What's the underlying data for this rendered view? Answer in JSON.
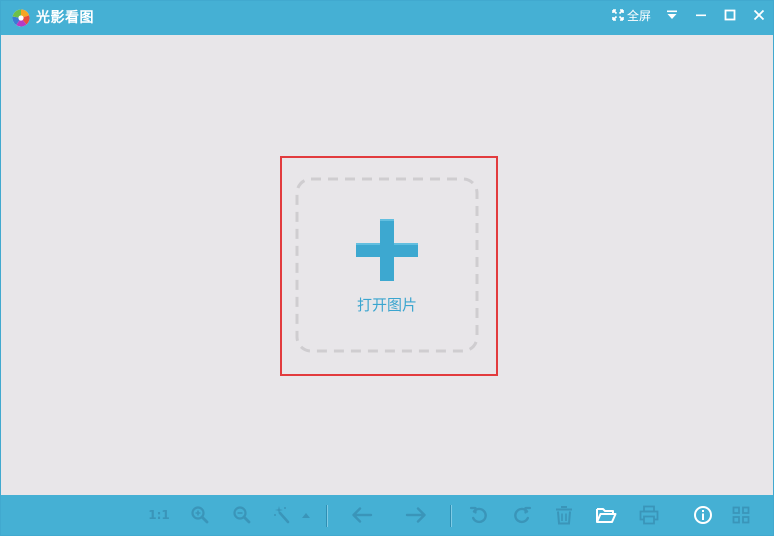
{
  "app": {
    "title": "光影看图",
    "fullscreen_label": "全屏"
  },
  "main": {
    "open_label": "打开图片"
  },
  "toolbar": {
    "ratio_label": "1:1",
    "items": [
      {
        "name": "actual-size",
        "icon": "ratio-1-1"
      },
      {
        "name": "zoom-in",
        "icon": "zoom-in-icon"
      },
      {
        "name": "zoom-out",
        "icon": "zoom-out-icon"
      },
      {
        "name": "edit",
        "icon": "magic-wand-icon"
      },
      {
        "name": "previous",
        "icon": "arrow-left-icon"
      },
      {
        "name": "next",
        "icon": "arrow-right-icon"
      },
      {
        "name": "rotate-left",
        "icon": "rotate-left-icon"
      },
      {
        "name": "rotate-right",
        "icon": "rotate-right-icon"
      },
      {
        "name": "delete",
        "icon": "trash-icon"
      },
      {
        "name": "open-folder",
        "icon": "folder-open-icon"
      },
      {
        "name": "print",
        "icon": "print-icon"
      },
      {
        "name": "info",
        "icon": "info-icon"
      },
      {
        "name": "grid-view",
        "icon": "grid-icon"
      }
    ]
  },
  "colors": {
    "title_bar": "#45b0d4",
    "background": "#e8e6e9",
    "accent": "#3ba5cf",
    "highlight": "#e23b3e",
    "disabled_icon": "#3a95b9",
    "enabled_icon": "#ffffff"
  }
}
